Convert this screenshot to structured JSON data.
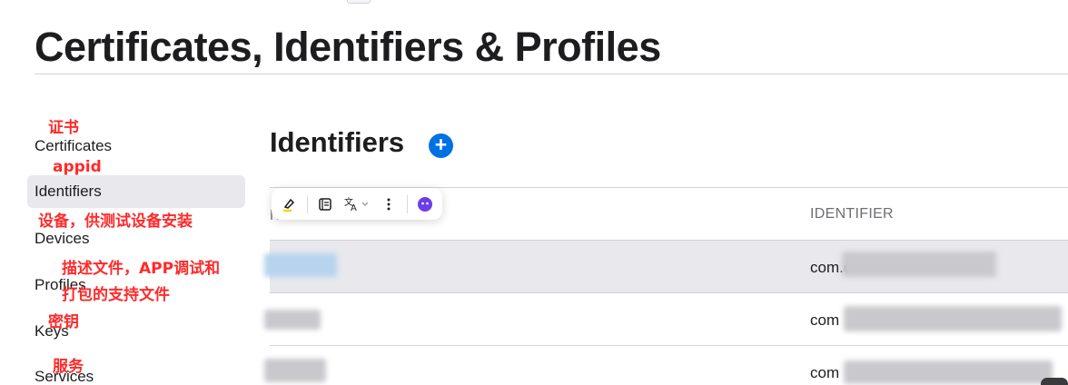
{
  "page": {
    "title": "Certificates, Identifiers & Profiles"
  },
  "sidebar": {
    "items": [
      {
        "label": "Certificates",
        "note": "证书",
        "active": false
      },
      {
        "label": "Identifiers",
        "note": "appid",
        "active": true
      },
      {
        "label": "Devices",
        "note": "设备，供测试设备安装",
        "active": false
      },
      {
        "label": "Profiles",
        "note": "描述文件，APP调试和打包的支持文件",
        "active": false
      },
      {
        "label": "Keys",
        "note": "密钥",
        "active": false
      },
      {
        "label": "Services",
        "note": "服务",
        "active": false
      }
    ],
    "notes_wrapped": {
      "profiles_line1": "描述文件，APP调试和",
      "profiles_line2": "打包的支持文件"
    }
  },
  "main": {
    "section_title": "Identifiers",
    "add_icon": "plus-circle-icon",
    "table": {
      "columns": {
        "name": "NAME",
        "identifier": "IDENTIFIER"
      },
      "rows": [
        {
          "identifier_prefix": "com.c",
          "selected": true
        },
        {
          "identifier_prefix": "com",
          "selected": false
        },
        {
          "identifier_prefix": "com",
          "selected": false
        }
      ]
    }
  },
  "toolbar": {
    "icons": [
      "highlighter-icon",
      "notes-icon",
      "translate-icon",
      "chevron-down-icon",
      "more-vertical-icon",
      "assistant-icon"
    ]
  },
  "colors": {
    "accent": "#0071e3",
    "annotation": "#ff2a2a",
    "selected_row": "#e8e8ed",
    "assistant": "#6c3de9"
  }
}
